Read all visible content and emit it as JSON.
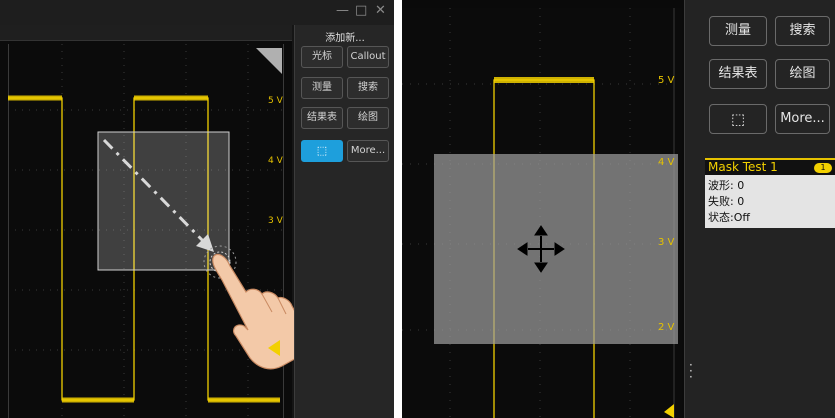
{
  "left": {
    "window_controls": {
      "minimize": "—",
      "maximize": "□",
      "close": "✕"
    },
    "side_panel": {
      "title": "添加新...",
      "buttons": [
        {
          "label": "光标"
        },
        {
          "label": "Callout"
        },
        {
          "label": "测量"
        },
        {
          "label": "搜索"
        },
        {
          "label": "结果表"
        },
        {
          "label": "绘图"
        },
        {
          "label": "",
          "icon": "mask-select-icon",
          "active": true
        },
        {
          "label": "More..."
        }
      ]
    },
    "voltage_labels": [
      "5 V",
      "4 V",
      "3 V"
    ]
  },
  "right": {
    "side_panel": {
      "buttons": [
        {
          "label": "测量"
        },
        {
          "label": "搜索"
        },
        {
          "label": "结果表"
        },
        {
          "label": "绘图"
        },
        {
          "label": "",
          "icon": "mask-select-icon"
        },
        {
          "label": "More..."
        }
      ]
    },
    "mask_card": {
      "title": "Mask Test 1",
      "badge": "1",
      "waveform": "波形: 0",
      "failures": "失败: 0",
      "status": "状态:Off"
    },
    "voltage_labels": [
      "5 V",
      "4 V",
      "3 V",
      "2 V"
    ]
  },
  "colors": {
    "trace": "#f2d000",
    "active_button": "#1e9fdc",
    "background": "#0b0b0b",
    "panel": "#262626"
  }
}
